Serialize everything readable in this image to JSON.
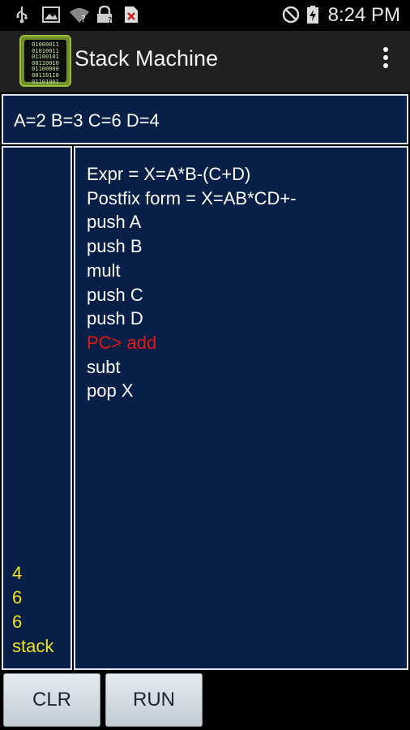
{
  "statusbar": {
    "time": "8:24 PM",
    "left_icons": [
      "usb-icon",
      "image-icon",
      "wifi-question-icon",
      "lock-icon",
      "error-notification-icon"
    ],
    "right_icons": [
      "do-not-disturb-icon",
      "battery-charging-icon"
    ]
  },
  "app": {
    "title": "Stack Machine",
    "icon_text": "01000011\n01010011\n01100101\n00110010\n01100000\n00110110\n01101001"
  },
  "variables": "A=2 B=3 C=6 D=4",
  "stack": {
    "items": [
      "4",
      "6",
      "6"
    ],
    "label": "stack"
  },
  "program": {
    "lines": [
      "Expr = X=A*B-(C+D)",
      "Postfix form = X=AB*CD+-",
      "push A",
      "push B",
      "mult",
      "push C",
      "push D",
      "PC> add",
      "subt",
      "pop X"
    ],
    "active_line": 7,
    "active_color": "#e01818"
  },
  "buttons": {
    "clr": "CLR",
    "run": "RUN"
  },
  "colors": {
    "panel_bg": "#082048",
    "stack_text": "#f2e21a",
    "actionbar_bg": "#202020"
  }
}
